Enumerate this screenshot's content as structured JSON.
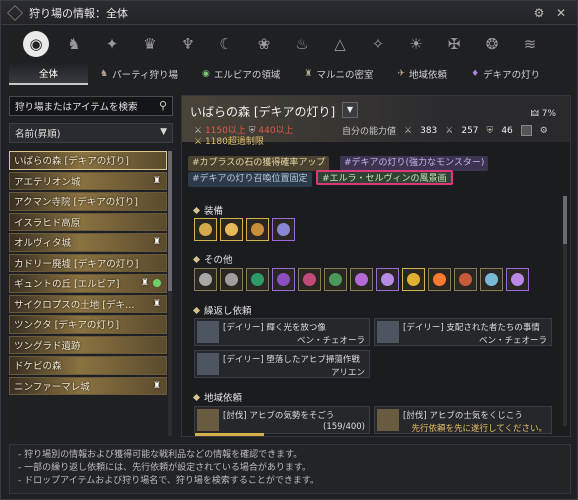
{
  "title": "狩り場の情報：全体",
  "category_icons": [
    "all-icon",
    "horse-icon",
    "beast-icon",
    "ogre-icon",
    "demon-icon",
    "moon-icon",
    "lotus-icon",
    "flame-icon",
    "triangle-icon",
    "star-icon",
    "sun-icon",
    "cross-icon",
    "orb-icon",
    "wave-icon"
  ],
  "subtabs": [
    {
      "label": "全体",
      "active": true
    },
    {
      "label": "パーティ狩り場"
    },
    {
      "label": "エルビアの領域"
    },
    {
      "label": "マルニの密室"
    },
    {
      "label": "地域依頼"
    },
    {
      "label": "デキアの灯り"
    }
  ],
  "search": {
    "value": "狩り場またはアイテムを検索"
  },
  "sort": {
    "value": "名前(昇順)"
  },
  "list": [
    "いばらの森 [デキアの灯り]",
    "アエテリオン城",
    "アクマン寺院 [デキアの灯り]",
    "イスラヒド高原",
    "オルヴィタ城",
    "カドリー廃墟 [デキアの灯り]",
    "ギュントの丘 [エルビア]",
    "サイクロプスの土地 [デキ…",
    "ツンクタ [デキアの灯り]",
    "ツングラド遺跡",
    "ドケビの森",
    "ニンファーマレ城"
  ],
  "detail": {
    "name": "いばらの森 [デキアの灯り]",
    "pct": "7%",
    "stat_atk": "1150以上",
    "stat_def": "440以上",
    "stat_dp": "1180超過制限",
    "mystat_label": "自分の能力値",
    "mystat_atk": "383",
    "mystat_def": "257",
    "mystat_dp": "46"
  },
  "tags": [
    "#カプラスの石の獲得確率アップ",
    "#デキアの灯り(強力なモンスター)",
    "#デキアの灯り召喚位置固定",
    "#エルラ・セルヴィンの風景画"
  ],
  "sections": {
    "equip": "装備",
    "other": "その他",
    "repeat": "繰返し依頼",
    "region": "地域依頼"
  },
  "repeat_quests": [
    {
      "title": "[デイリー] 輝く光を放つ像",
      "npc": "ベン・チェオーラ"
    },
    {
      "title": "[デイリー] 支配された者たちの事情",
      "npc": "ベン・チェオーラ"
    },
    {
      "title": "[デイリー] 堕落したアヒブ掃蕩作戦",
      "npc": "アリエン"
    }
  ],
  "region_quests": [
    {
      "title": "[討伐] アヒブの気勢をそごう",
      "progress": "(159/400)",
      "progress_value": 0.3975
    },
    {
      "title": "[討伐] アヒブの士気をくじこう",
      "note": "先行依頼を先に遂行してください。"
    }
  ],
  "footer": [
    "- 狩り場別の情報および獲得可能な戦利品などの情報を確認できます。",
    "- 一部の繰り返し依頼には、先行依頼が設定されている場合があります。",
    "- ドロップアイテムおよび狩り場名で、狩り場を検索することができます。"
  ]
}
